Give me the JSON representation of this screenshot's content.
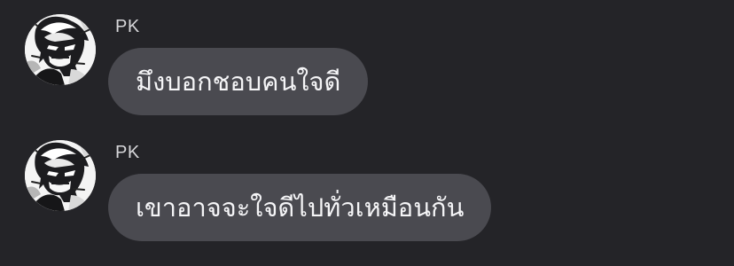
{
  "messages": [
    {
      "sender": "PK",
      "text": "มึงบอกชอบคนใจดี",
      "avatar_icon": "monochrome-character-avatar-icon"
    },
    {
      "sender": "PK",
      "text": "เขาอาจจะใจดีไปทั่วเหมือนกัน",
      "avatar_icon": "monochrome-character-avatar-icon"
    }
  ],
  "colors": {
    "background": "#242428",
    "bubble": "#4a4a50",
    "text": "#f5f5f7",
    "sender_name": "#d7d7da"
  }
}
